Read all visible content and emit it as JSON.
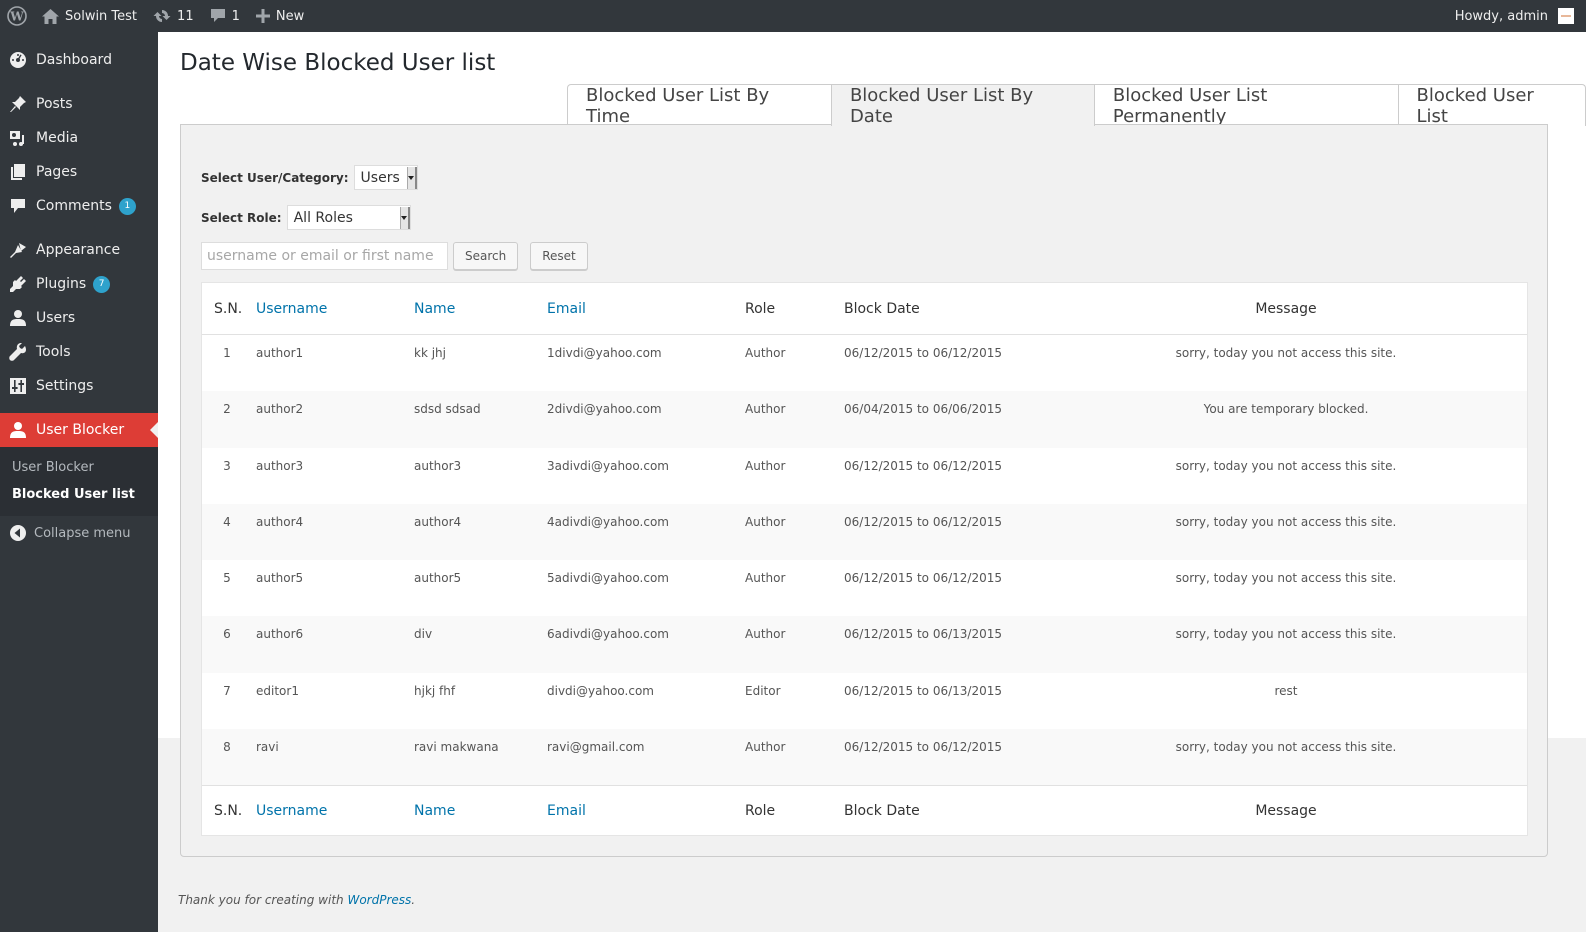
{
  "adminbar": {
    "site_name": "Solwin Test",
    "updates_count": "11",
    "comments_count": "1",
    "new_label": "New",
    "howdy": "Howdy, admin"
  },
  "sidebar": {
    "items": [
      {
        "label": "Dashboard",
        "icon": "dashboard-icon"
      },
      {
        "label": "Posts",
        "icon": "pin-icon"
      },
      {
        "label": "Media",
        "icon": "media-icon"
      },
      {
        "label": "Pages",
        "icon": "pages-icon"
      },
      {
        "label": "Comments",
        "icon": "comment-icon",
        "badge": "1"
      },
      {
        "label": "Appearance",
        "icon": "brush-icon"
      },
      {
        "label": "Plugins",
        "icon": "plugin-icon",
        "badge": "7"
      },
      {
        "label": "Users",
        "icon": "user-icon"
      },
      {
        "label": "Tools",
        "icon": "wrench-icon"
      },
      {
        "label": "Settings",
        "icon": "settings-icon"
      },
      {
        "label": "User Blocker",
        "icon": "user-icon",
        "current": true
      }
    ],
    "submenu": [
      "User Blocker",
      "Blocked User list"
    ],
    "collapse_label": "Collapse menu"
  },
  "page": {
    "title": "Date Wise Blocked User list",
    "tabs": [
      {
        "label": "Blocked User List By Time",
        "active": false
      },
      {
        "label": "Blocked User List By Date",
        "active": true
      },
      {
        "label": "Blocked User List Permanently",
        "active": false
      },
      {
        "label": "Blocked User List",
        "active": false
      }
    ]
  },
  "filters": {
    "category_label": "Select User/Category:",
    "category_value": "Users",
    "role_label": "Select Role:",
    "role_value": "All Roles",
    "search_placeholder": "username or email or first name",
    "search_value": "",
    "search_button": "Search",
    "reset_button": "Reset"
  },
  "table": {
    "columns": [
      "S.N.",
      "Username",
      "Name",
      "Email",
      "Role",
      "Block Date",
      "Message"
    ],
    "rows": [
      {
        "sn": "1",
        "username": "author1",
        "name": "kk jhj",
        "email": "1divdi@yahoo.com",
        "role": "Author",
        "date": "06/12/2015 to 06/12/2015",
        "message": "sorry, today you not access this site."
      },
      {
        "sn": "2",
        "username": "author2",
        "name": "sdsd sdsad",
        "email": "2divdi@yahoo.com",
        "role": "Author",
        "date": "06/04/2015 to 06/06/2015",
        "message": "You are temporary blocked."
      },
      {
        "sn": "3",
        "username": "author3",
        "name": "author3",
        "email": "3adivdi@yahoo.com",
        "role": "Author",
        "date": "06/12/2015 to 06/12/2015",
        "message": "sorry, today you not access this site."
      },
      {
        "sn": "4",
        "username": "author4",
        "name": "author4",
        "email": "4adivdi@yahoo.com",
        "role": "Author",
        "date": "06/12/2015 to 06/12/2015",
        "message": "sorry, today you not access this site."
      },
      {
        "sn": "5",
        "username": "author5",
        "name": "author5",
        "email": "5adivdi@yahoo.com",
        "role": "Author",
        "date": "06/12/2015 to 06/12/2015",
        "message": "sorry, today you not access this site."
      },
      {
        "sn": "6",
        "username": "author6",
        "name": "div",
        "email": "6adivdi@yahoo.com",
        "role": "Author",
        "date": "06/12/2015 to 06/13/2015",
        "message": "sorry, today you not access this site."
      },
      {
        "sn": "7",
        "username": "editor1",
        "name": "hjkj fhf",
        "email": "divdi@yahoo.com",
        "role": "Editor",
        "date": "06/12/2015 to 06/13/2015",
        "message": "rest"
      },
      {
        "sn": "8",
        "username": "ravi",
        "name": "ravi makwana",
        "email": "ravi@gmail.com",
        "role": "Author",
        "date": "06/12/2015 to 06/12/2015",
        "message": "sorry, today you not access this site."
      }
    ]
  },
  "footer": {
    "text": "Thank you for creating with ",
    "link": "WordPress",
    "suffix": "."
  },
  "colors": {
    "adminbar_bg": "#32373c",
    "current_menu": "#dd3d36",
    "link": "#0073aa",
    "badge": "#2ea2cc"
  }
}
